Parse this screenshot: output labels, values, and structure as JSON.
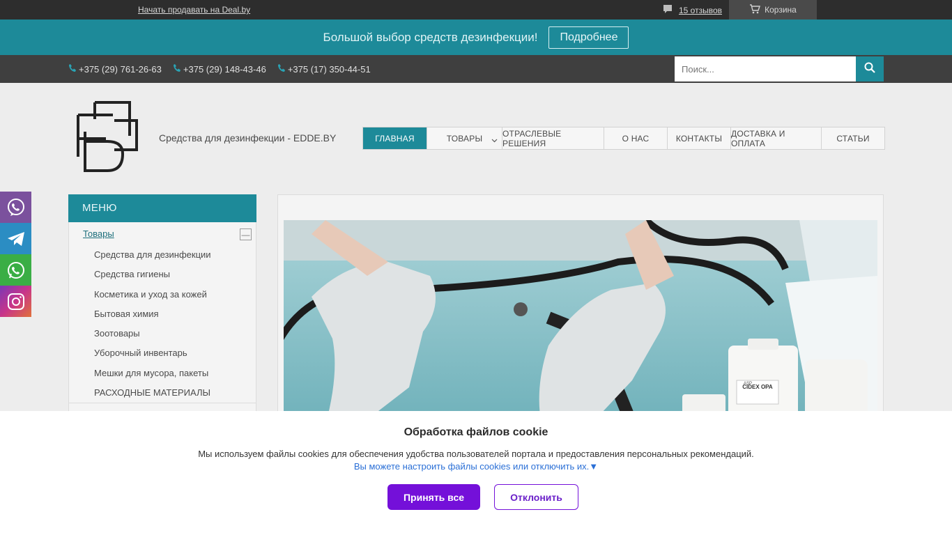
{
  "topbar": {
    "sell_link": "Начать продавать на Deal.by",
    "reviews": "15 отзывов",
    "cart": "Корзина"
  },
  "promo": {
    "text": "Большой выбор средств дезинфекции!",
    "button": "Подробнее"
  },
  "phones": [
    "+375 (29) 761-26-63",
    "+375 (29) 148-43-46",
    "+375 (17) 350-44-51"
  ],
  "search": {
    "placeholder": "Поиск..."
  },
  "header": {
    "tagline": "Средства для дезинфекции - EDDE.BY"
  },
  "nav": [
    {
      "label": "ГЛАВНАЯ",
      "active": true
    },
    {
      "label": "ТОВАРЫ"
    },
    {
      "label": "ОТРАСЛЕВЫЕ РЕШЕНИЯ"
    },
    {
      "label": "О НАС"
    },
    {
      "label": "КОНТАКТЫ"
    },
    {
      "label": "ДОСТАВКА И ОПЛАТА"
    },
    {
      "label": "СТАТЬИ"
    }
  ],
  "social": [
    {
      "name": "viber",
      "color": "#7b519d"
    },
    {
      "name": "telegram",
      "color": "#2b8dc3"
    },
    {
      "name": "whatsapp",
      "color": "#3aae45"
    },
    {
      "name": "instagram",
      "color": "#a23ea4"
    }
  ],
  "sidebar": {
    "title": "МЕНЮ",
    "category": "Товары",
    "toggle": "—",
    "items": [
      "Средства для дезинфекции",
      "Средства гигиены",
      "Косметика и уход за кожей",
      "Бытовая химия",
      "Зоотовары",
      "Уборочный инвентарь",
      "Мешки для мусора, пакеты",
      "РАСХОДНЫЕ МАТЕРИАЛЫ"
    ]
  },
  "hero": {
    "bottle_label": "CIDEX OPA",
    "bottle_brand": "ASP"
  },
  "cookie": {
    "title": "Обработка файлов cookie",
    "text": "Мы используем файлы cookies для обеспечения удобства пользователей портала и предоставления персональных рекомендаций.",
    "link": "Вы можете настроить файлы cookies или отключить их.▼",
    "accept": "Принять все",
    "decline": "Отклонить"
  },
  "colors": {
    "accent": "#1d8a99",
    "purple": "#7410d9"
  }
}
